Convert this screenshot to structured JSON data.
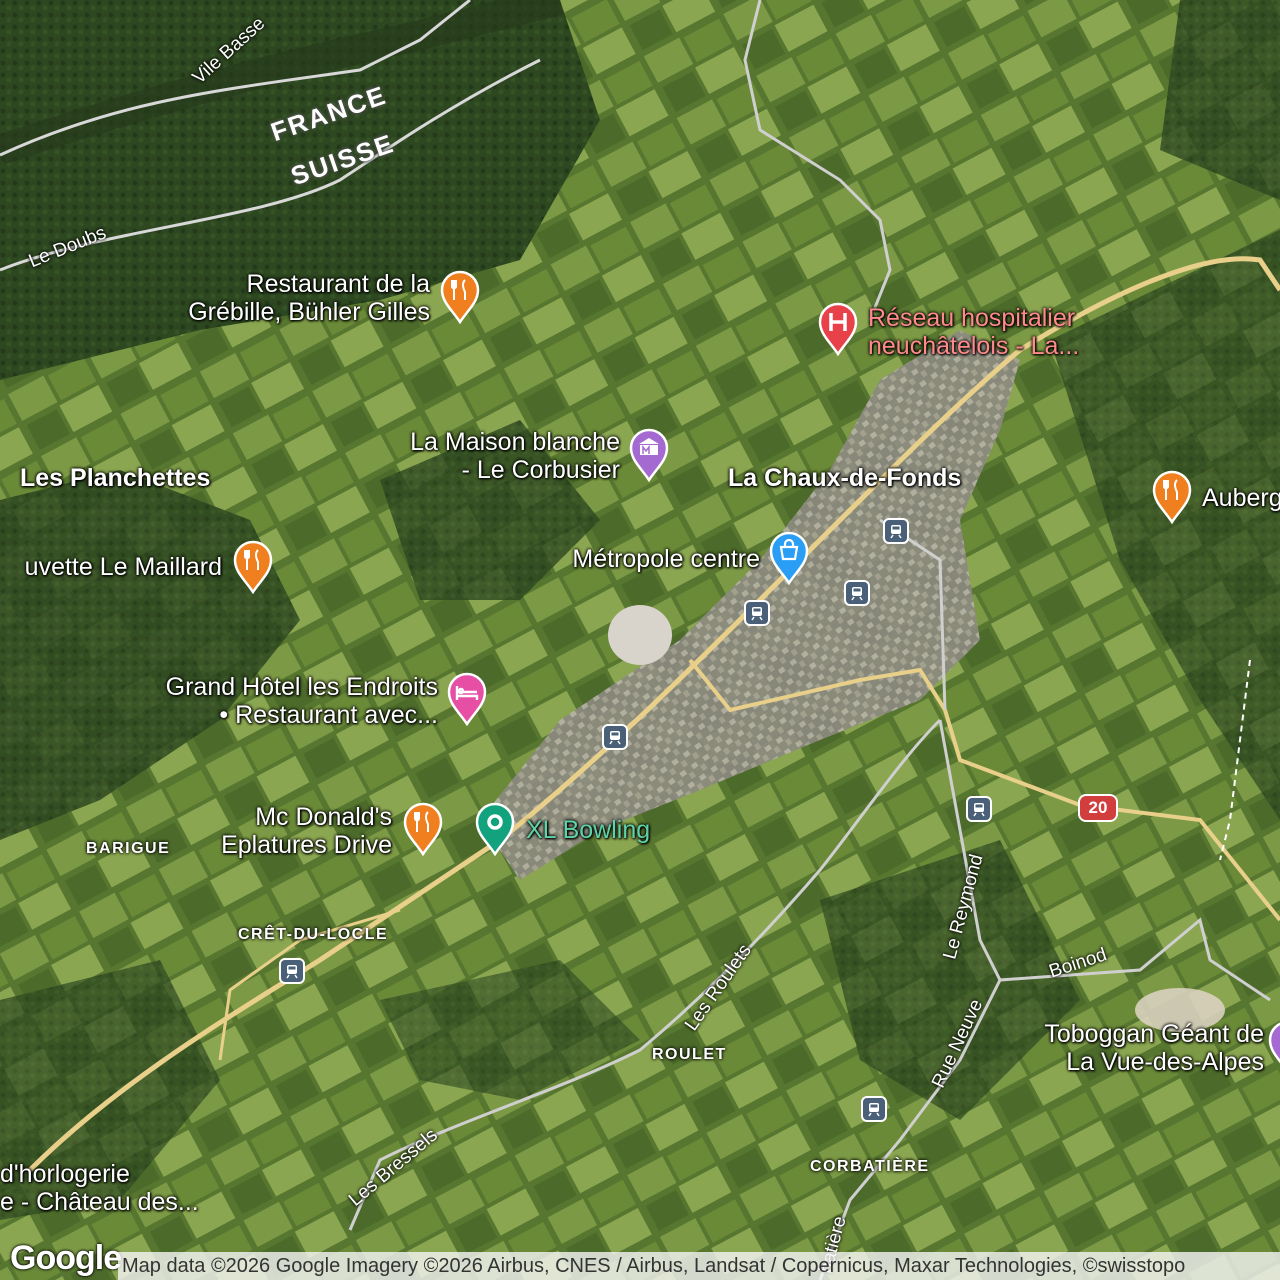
{
  "map": {
    "type": "satellite",
    "colors": {
      "forest": "#2e4a1f",
      "field": "#6f8f3f",
      "road": "#e8cf8a",
      "urban": "#9a9a90"
    }
  },
  "border": {
    "north": "FRANCE",
    "south": "SUISSE"
  },
  "places": {
    "la_chaux_de_fonds": "La Chaux-de-Fonds",
    "les_planchettes": "Les Planchettes",
    "barigue": "BARIGUE",
    "cret_du_locle": "CRÊT-DU-LOCLE",
    "roulet": "ROULET",
    "corbatiere": "CORBATIÈRE"
  },
  "roads": {
    "ville_basse": "Vile Basse",
    "le_doubs": "Le Doubs",
    "les_roulets": "Les Roulets",
    "les_bressels": "Les Bressels",
    "le_reymond": "Le Reymond",
    "rue_neuve": "Rue Neuve",
    "boinod": "Boinod",
    "corbatiere_road": "batière",
    "route_20": "20"
  },
  "pois": [
    {
      "id": "restaurant-grebille",
      "line1": "Restaurant de la",
      "line2": "Grébille, Bühler Gilles",
      "icon": "restaurant-icon",
      "color": "#f0801f"
    },
    {
      "id": "hospital",
      "line1": "Réseau hospitalier",
      "line2": "neuchâtelois - La...",
      "icon": "hospital-icon",
      "color": "#e8414a"
    },
    {
      "id": "maison-blanche",
      "line1": "La Maison blanche",
      "line2": "- Le Corbusier",
      "icon": "museum-icon",
      "color": "#a46ad1"
    },
    {
      "id": "auberge",
      "line1": "Auberg",
      "line2": "",
      "icon": "restaurant-icon",
      "color": "#f0801f"
    },
    {
      "id": "buvette-maillard",
      "line1": "uvette Le Maillard",
      "line2": "",
      "icon": "restaurant-icon",
      "color": "#f0801f"
    },
    {
      "id": "metropole",
      "line1": "Métropole centre",
      "line2": "",
      "icon": "shopping-icon",
      "color": "#2a9df4"
    },
    {
      "id": "grand-hotel",
      "line1": "Grand Hôtel les Endroits",
      "line2": "• Restaurant avec...",
      "icon": "hotel-icon",
      "color": "#e64fa3"
    },
    {
      "id": "mcdonalds",
      "line1": "Mc Donald's",
      "line2": "Eplatures Drive",
      "icon": "restaurant-icon",
      "color": "#f0801f"
    },
    {
      "id": "xl-bowling",
      "line1": "XL Bowling",
      "line2": "",
      "icon": "place-icon",
      "color": "#12a37e"
    },
    {
      "id": "toboggan",
      "line1": "Toboggan Géant de",
      "line2": "La Vue-des-Alpes",
      "icon": "attraction-icon",
      "color": "#a46ad1"
    },
    {
      "id": "horlogerie",
      "line1": "d'horlogerie",
      "line2": "e -  Château des...",
      "icon": "",
      "color": ""
    }
  ],
  "footer": {
    "logo": "Google",
    "attribution": "Map data ©2026 Google Imagery ©2026 Airbus, CNES / Airbus, Landsat / Copernicus, Maxar Technologies, ©swisstopo"
  }
}
